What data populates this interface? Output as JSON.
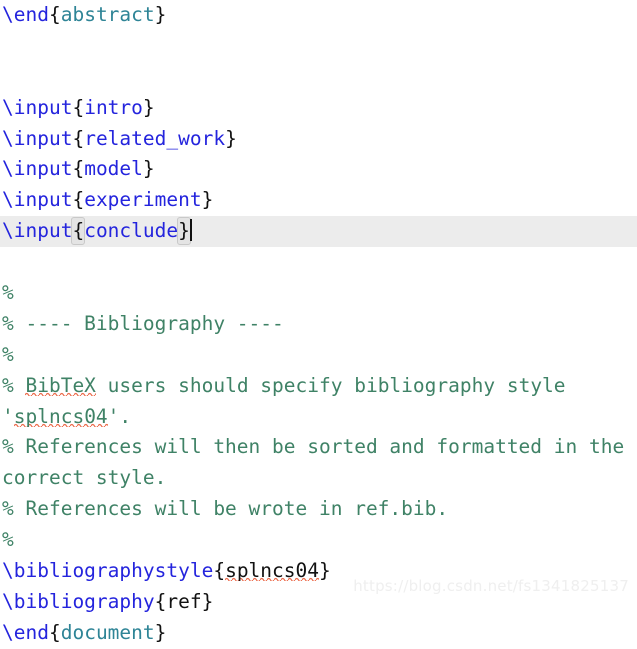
{
  "editor": {
    "language": "latex",
    "colors": {
      "background": "#ffffff",
      "command": "#2424dd",
      "environment": "#2e8496",
      "comment": "#3f8266",
      "plain": "#111111",
      "current_line_highlight": "#ececec",
      "brace_match_bg": "#e4e4e4",
      "spellcheck_squiggle": "#eb6a4a",
      "caret": "#111111",
      "watermark": "#efefef"
    },
    "caret_line_index": 6,
    "lines": [
      {
        "index": 0,
        "current": false,
        "tokens": [
          {
            "kind": "cmd",
            "text": "\\end"
          },
          {
            "kind": "brace",
            "text": "{"
          },
          {
            "kind": "env",
            "text": "abstract"
          },
          {
            "kind": "brace",
            "text": "}"
          }
        ]
      },
      {
        "index": 1,
        "current": false,
        "tokens": []
      },
      {
        "index": 2,
        "current": false,
        "tokens": []
      },
      {
        "index": 3,
        "current": false,
        "tokens": [
          {
            "kind": "cmd",
            "text": "\\input"
          },
          {
            "kind": "brace",
            "text": "{"
          },
          {
            "kind": "cmd",
            "text": "intro"
          },
          {
            "kind": "brace",
            "text": "}"
          }
        ]
      },
      {
        "index": 4,
        "current": false,
        "tokens": [
          {
            "kind": "cmd",
            "text": "\\input"
          },
          {
            "kind": "brace",
            "text": "{"
          },
          {
            "kind": "cmd",
            "text": "related_work"
          },
          {
            "kind": "brace",
            "text": "}"
          }
        ]
      },
      {
        "index": 5,
        "current": false,
        "tokens": [
          {
            "kind": "cmd",
            "text": "\\input"
          },
          {
            "kind": "brace",
            "text": "{"
          },
          {
            "kind": "cmd",
            "text": "model"
          },
          {
            "kind": "brace",
            "text": "}"
          }
        ]
      },
      {
        "index": 6,
        "current": false,
        "tokens": [
          {
            "kind": "cmd",
            "text": "\\input"
          },
          {
            "kind": "brace",
            "text": "{"
          },
          {
            "kind": "cmd",
            "text": "experiment"
          },
          {
            "kind": "brace",
            "text": "}"
          }
        ]
      },
      {
        "index": 7,
        "current": true,
        "tokens": [
          {
            "kind": "cmd",
            "text": "\\input"
          },
          {
            "kind": "brace-match",
            "text": "{"
          },
          {
            "kind": "cmd",
            "text": "conclude"
          },
          {
            "kind": "brace-match",
            "text": "}"
          },
          {
            "kind": "caret",
            "text": ""
          }
        ]
      },
      {
        "index": 8,
        "current": false,
        "tokens": []
      },
      {
        "index": 9,
        "current": false,
        "tokens": [
          {
            "kind": "comment",
            "text": "%"
          }
        ]
      },
      {
        "index": 10,
        "current": false,
        "tokens": [
          {
            "kind": "comment",
            "text": "% ---- Bibliography ----"
          }
        ]
      },
      {
        "index": 11,
        "current": false,
        "tokens": [
          {
            "kind": "comment",
            "text": "%"
          }
        ]
      },
      {
        "index": 12,
        "current": false,
        "tokens": [
          {
            "kind": "comment",
            "text": "% "
          },
          {
            "kind": "comment-misspell",
            "text": "BibTeX"
          },
          {
            "kind": "comment",
            "text": " users should specify bibliography style"
          }
        ]
      },
      {
        "index": 13,
        "current": false,
        "wrapped": true,
        "tokens": [
          {
            "kind": "comment",
            "text": "'"
          },
          {
            "kind": "comment-misspell",
            "text": "splncs04"
          },
          {
            "kind": "comment",
            "text": "'."
          }
        ]
      },
      {
        "index": 14,
        "current": false,
        "tokens": [
          {
            "kind": "comment",
            "text": "% References will then be sorted and formatted in the"
          }
        ]
      },
      {
        "index": 15,
        "current": false,
        "wrapped": true,
        "tokens": [
          {
            "kind": "comment",
            "text": "correct style."
          }
        ]
      },
      {
        "index": 16,
        "current": false,
        "tokens": [
          {
            "kind": "comment",
            "text": "% References will be wrote in ref.bib."
          }
        ]
      },
      {
        "index": 17,
        "current": false,
        "tokens": [
          {
            "kind": "comment",
            "text": "%"
          }
        ]
      },
      {
        "index": 18,
        "current": false,
        "tokens": [
          {
            "kind": "cmd",
            "text": "\\bibliographystyle"
          },
          {
            "kind": "brace",
            "text": "{"
          },
          {
            "kind": "plain-misspell",
            "text": "splncs04"
          },
          {
            "kind": "brace",
            "text": "}"
          }
        ]
      },
      {
        "index": 19,
        "current": false,
        "tokens": [
          {
            "kind": "cmd",
            "text": "\\bibliography"
          },
          {
            "kind": "brace",
            "text": "{"
          },
          {
            "kind": "plain",
            "text": "ref"
          },
          {
            "kind": "brace",
            "text": "}"
          }
        ]
      },
      {
        "index": 20,
        "current": false,
        "tokens": [
          {
            "kind": "cmd",
            "text": "\\end"
          },
          {
            "kind": "brace",
            "text": "{"
          },
          {
            "kind": "env",
            "text": "document"
          },
          {
            "kind": "brace",
            "text": "}"
          }
        ]
      }
    ]
  },
  "watermark": {
    "text": "https://blog.csdn.net/fs1341825137"
  }
}
